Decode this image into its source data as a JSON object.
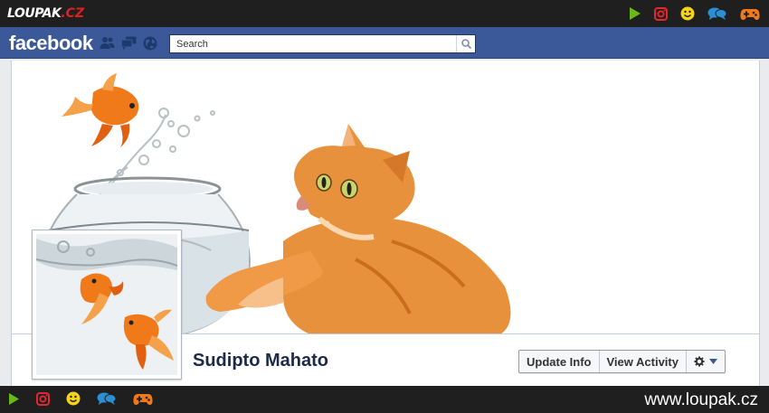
{
  "site": {
    "logo_main": "LOUPAK",
    "logo_tld": ".CZ",
    "watermark_url": "www.loupak.cz",
    "icons": [
      "play-icon",
      "instagram-icon",
      "smiley-icon",
      "chat-icon",
      "gamepad-icon"
    ],
    "colors": {
      "play": "#6bb81a",
      "instagram": "#e0282e",
      "smiley": "#f5d21c",
      "chat": "#2b8fd6",
      "gamepad": "#f07a1a"
    }
  },
  "facebook": {
    "logo": "facebook",
    "search_placeholder": "Search",
    "jewels": [
      "friend-requests-icon",
      "messages-icon",
      "notifications-icon"
    ],
    "brand_color": "#3b5998"
  },
  "profile": {
    "name": "Sudipto Mahato",
    "update_info_label": "Update Info",
    "view_activity_label": "View Activity",
    "settings_icon": "gear-icon"
  }
}
